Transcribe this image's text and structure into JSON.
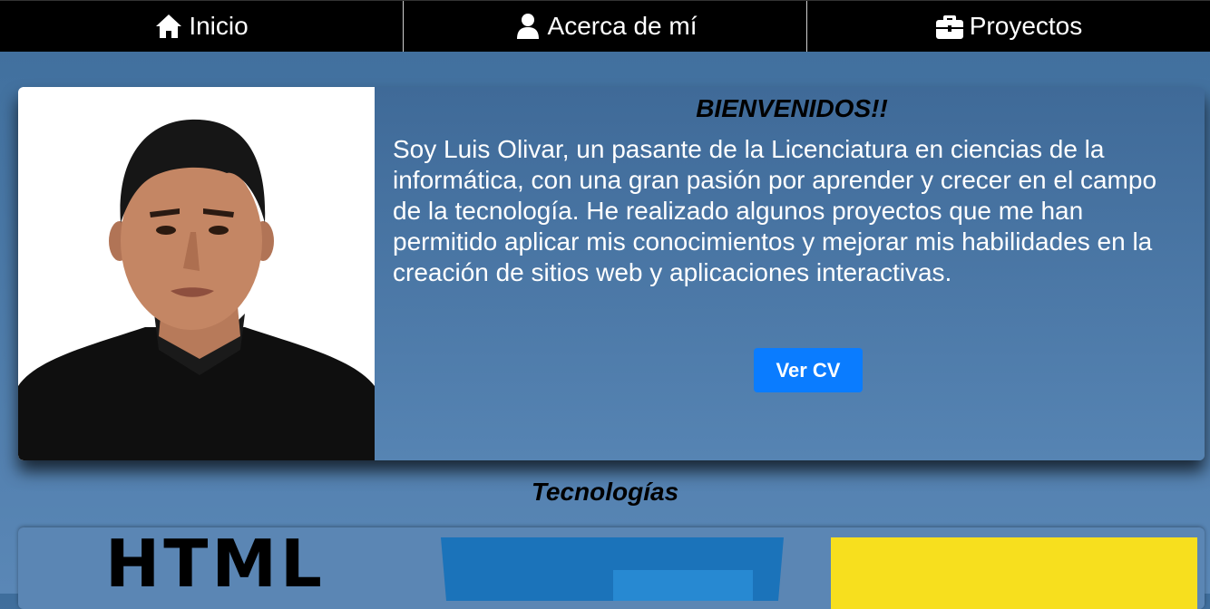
{
  "nav": {
    "items": [
      {
        "label": "Inicio",
        "icon": "home-icon"
      },
      {
        "label": "Acerca de mí",
        "icon": "user-icon"
      },
      {
        "label": "Proyectos",
        "icon": "briefcase-icon"
      }
    ]
  },
  "hero": {
    "title": "BIENVENIDOS!!",
    "bio": "Soy Luis Olivar, un pasante de la Licenciatura en ciencias de la informática, con una gran pasión por aprender y crecer en el campo de la tecnología. He realizado algunos proyectos que me han permitido aplicar mis conocimientos y mejorar mis habilidades en la creación de sitios web y aplicaciones interactivas.",
    "cv_button": "Ver CV"
  },
  "tech": {
    "title": "Tecnologías",
    "html_logo_text": "HTML"
  },
  "colors": {
    "nav_bg": "#000000",
    "page_bg": "#4f7db0",
    "button": "#0a7cff",
    "js_yellow": "#f7df1e",
    "css_blue": "#1b73ba"
  }
}
